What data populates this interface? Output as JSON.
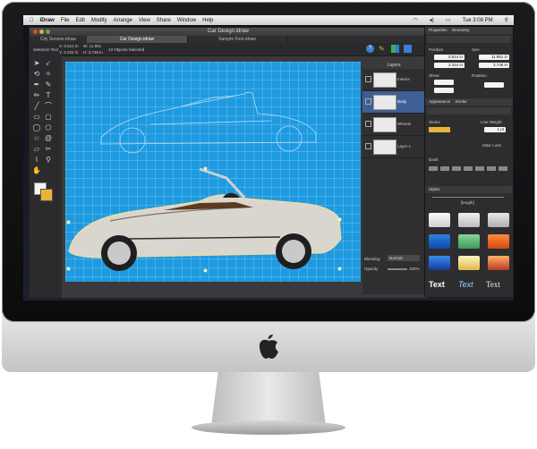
{
  "menubar": {
    "apple": "",
    "items": [
      "iDraw",
      "File",
      "Edit",
      "Modify",
      "Arrange",
      "View",
      "Share",
      "Window",
      "Help"
    ],
    "clock": "Tue 3:08 PM"
  },
  "window": {
    "title": "Car Design.idraw",
    "tabs": [
      "City Sunrise.idraw",
      "Car Design.idraw",
      "Sample Font.idraw"
    ],
    "info": {
      "tool": "Selection Tool",
      "x": "X: 0.514 in",
      "y": "Y: 3.344 in",
      "w": "W: 11.951",
      "h": "H: 3.748 in",
      "selected": "13 Objects Selected"
    }
  },
  "layers": {
    "header": "Layers",
    "rows": [
      "Interior",
      "Body",
      "Wheels",
      "Layer 1"
    ],
    "blending_label": "Blending",
    "blending_value": "Normal",
    "opacity_label": "Opacity",
    "opacity_value": "100%"
  },
  "inspector": {
    "properties_title": "Properties",
    "geometry_tab": "Geometry",
    "position_label": "Position",
    "size_label": "Size",
    "pos_x": "0.514 in",
    "pos_y": "3.344 in",
    "size_w": "11.951 in",
    "size_h": "3.748 in",
    "shear_label": "Shear",
    "rotation_label": "Rotation",
    "appearance_title": "Appearance",
    "stroke_section": "Stroke",
    "stroke_label": "Stroke",
    "line_weight_label": "Line Weight",
    "line_weight_value": "1 pt",
    "miter_label": "Miter Limit",
    "dash_label": "Dash",
    "styles_title": "Styles",
    "length_label": "[length]",
    "text_styles": [
      "Text",
      "Text",
      "Text"
    ]
  },
  "colors": {
    "canvas_blue": "#1e9ae0",
    "selection_blue": "#3e5f93"
  }
}
